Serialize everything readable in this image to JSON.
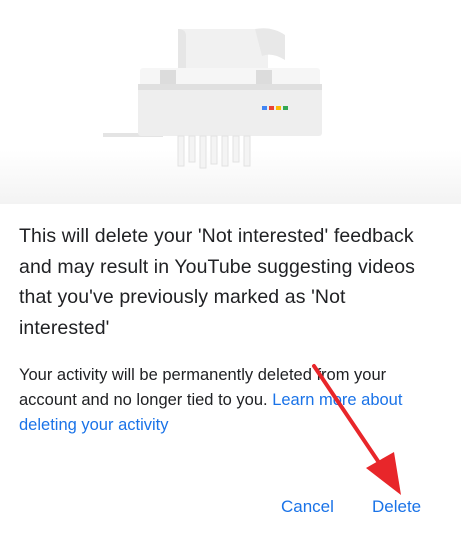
{
  "dialog": {
    "illustration": "paper-shredder-illustration",
    "title": "This will delete your 'Not interested' feedback and may result in YouTube suggesting videos that you've previously marked as 'Not interested'",
    "body": "Your activity will be permanently deleted from your account and no longer tied to you. ",
    "learn_more_link": "Learn more about deleting your activity",
    "cancel_label": "Cancel",
    "delete_label": "Delete"
  },
  "colors": {
    "accent": "#1a73e8",
    "text": "#202124",
    "annotation_arrow": "#e8262a",
    "google_dots": [
      "#4285f4",
      "#ea4335",
      "#fbbc04",
      "#34a853"
    ]
  }
}
